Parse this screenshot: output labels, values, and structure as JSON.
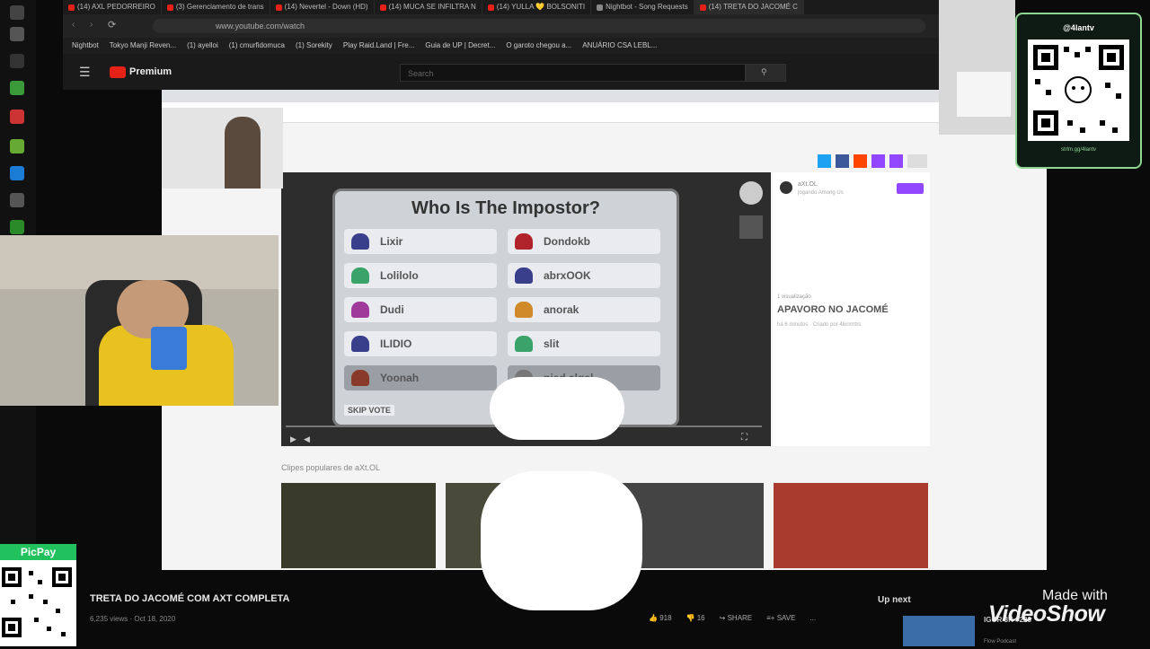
{
  "browser": {
    "tabs": [
      {
        "label": "(14) AXL PEDORREIRO"
      },
      {
        "label": "(3) Gerenciamento de trans"
      },
      {
        "label": "(14) Nevertel - Down (HD)"
      },
      {
        "label": "(14) MUCA SE INFILTRA N"
      },
      {
        "label": "(14) YULLA 💛 BOLSONITI"
      },
      {
        "label": "Nightbot - Song Requests"
      },
      {
        "label": "(14) TRETA DO JACOMÉ C"
      }
    ],
    "url": "www.youtube.com/watch",
    "bookmarks": [
      "Nightbot",
      "Tokyo Manji Reven...",
      "(1) ayelloi",
      "(1) cmurfidomuca",
      "(1) Sorekity",
      "Play Raid.Land | Fre...",
      "Guia de UP | Decret...",
      "O garoto chegou a...",
      "ANUÁRIO CSA LEBL..."
    ]
  },
  "youtube": {
    "logo_text": "Premium",
    "search_placeholder": "Search"
  },
  "clip": {
    "game_title": "Who Is The Impostor?",
    "players_left": [
      "Lixir",
      "Lolilolo",
      "Dudi",
      "ILIDIO",
      "Yoonah"
    ],
    "players_right": [
      "Dondokb",
      "abrxOOK",
      "anorak",
      "slit",
      "pied algal"
    ],
    "colors_left": [
      "#3a3f8c",
      "#3aa36a",
      "#a03a9a",
      "#3a3f8c",
      "#8a3a2a"
    ],
    "colors_right": [
      "#b0232b",
      "#3a3f8c",
      "#d08a2a",
      "#3aa36a",
      "#777777"
    ],
    "skip_label": "SKIP VOTE",
    "channel_name": "aXt.OL",
    "channel_sub": "jogando Among Us",
    "views_label": "1 visualização",
    "clip_title": "APAVORO NO JACOMÉ",
    "clip_meta": "há 6 minutos · Criado por 4lunrrrtrs",
    "clips_heading": "Clipes populares de aXt.OL"
  },
  "overlay": {
    "qr_handle": "@4lantv",
    "qr_url": "strlm.gg/4lantv",
    "picpay_label": "PicPay"
  },
  "video": {
    "title": "TRETA DO JACOMÉ COM AXT COMPLETA",
    "meta": "6,235 views · Oct 18, 2020",
    "likes": "918",
    "dislikes": "16",
    "share_label": "SHARE",
    "save_label": "SAVE",
    "more_label": "..."
  },
  "up_next": {
    "label": "Up next",
    "title": "IGOR 3K #228",
    "channel": "Flow Podcast"
  },
  "watermark": {
    "line1": "Made with",
    "line2": "VideoShow"
  }
}
